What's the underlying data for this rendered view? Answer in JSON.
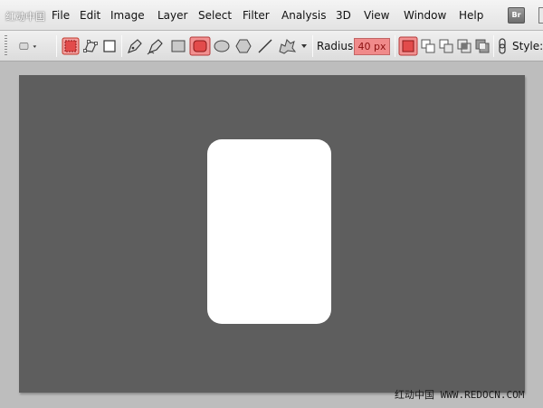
{
  "watermarks": {
    "top_left": "红动中国",
    "bottom_right": "红动中国 WWW.REDOCN.COM"
  },
  "menu": {
    "items": [
      "File",
      "Edit",
      "Image",
      "Layer",
      "Select",
      "Filter",
      "Analysis",
      "3D",
      "View",
      "Window",
      "Help"
    ],
    "bridge_label": "Br"
  },
  "options": {
    "radius_label": "Radius:",
    "radius_value": "40 px",
    "style_label": "Style:"
  },
  "colors": {
    "canvas": "#5e5e5e",
    "shape_fill": "#ffffff",
    "active_tool": "#e24b4b",
    "radius_field": "#f08a8a"
  },
  "icons": {
    "preset": "rounded-rectangle-preset-icon",
    "shape_layers": "shape-layers-icon",
    "paths": "paths-icon",
    "fill_pixels": "fill-pixels-icon",
    "pen": "pen-icon",
    "freeform_pen": "freeform-pen-icon",
    "rectangle": "rectangle-tool-icon",
    "rounded_rectangle": "rounded-rectangle-tool-icon",
    "ellipse": "ellipse-tool-icon",
    "polygon": "polygon-tool-icon",
    "line": "line-tool-icon",
    "custom_shape": "custom-shape-tool-icon",
    "link": "link-icon"
  }
}
